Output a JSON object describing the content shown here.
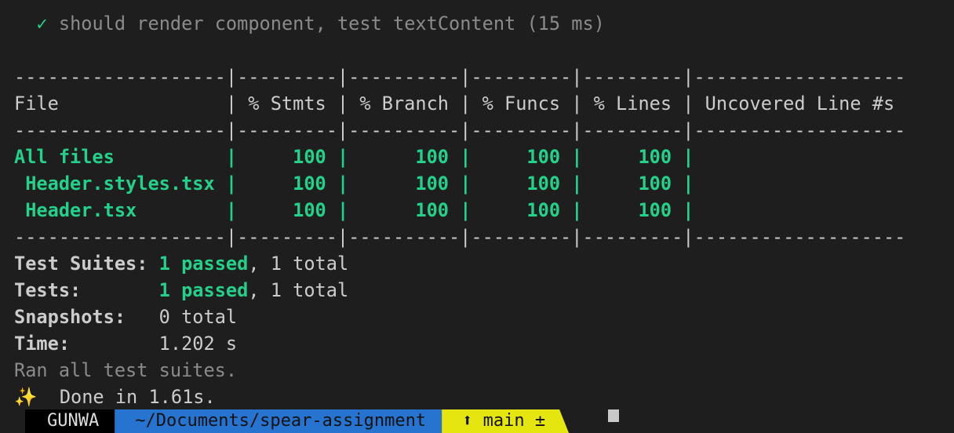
{
  "test_line": {
    "check": "✓",
    "text": "should render component, test textContent (15 ms)"
  },
  "table": {
    "separator": "-------------------|---------|----------|---------|---------|-------------------",
    "header": "File               | % Stmts | % Branch | % Funcs | % Lines | Uncovered Line #s ",
    "rows": [
      {
        "file": "All files         ",
        "cols": "|     100 |      100 |     100 |     100 |                   "
      },
      {
        "file": " Header.styles.tsx",
        "cols": "|     100 |      100 |     100 |     100 |                   "
      },
      {
        "file": " Header.tsx       ",
        "cols": "|     100 |      100 |     100 |     100 |                   "
      }
    ]
  },
  "summary": {
    "suites_label": "Test Suites: ",
    "suites_passed": "1 passed",
    "suites_total": ", 1 total",
    "tests_label": "Tests:       ",
    "tests_passed": "1 passed",
    "tests_total": ", 1 total",
    "snapshots_label": "Snapshots:   ",
    "snapshots_value": "0 total",
    "time_label": "Time:        ",
    "time_value": "1.202 s",
    "ran": "Ran all test suites."
  },
  "done": {
    "icon": "✨",
    "text": "Done in 1.61s."
  },
  "prompt": {
    "user": "GUNWA",
    "path": "~/Documents/spear-assignment",
    "branch": "⬆ main ±"
  },
  "colors": {
    "green": "#23d18b",
    "background": "#1e1e1e",
    "path_bg": "#2674cf",
    "branch_bg": "#e5e510"
  }
}
